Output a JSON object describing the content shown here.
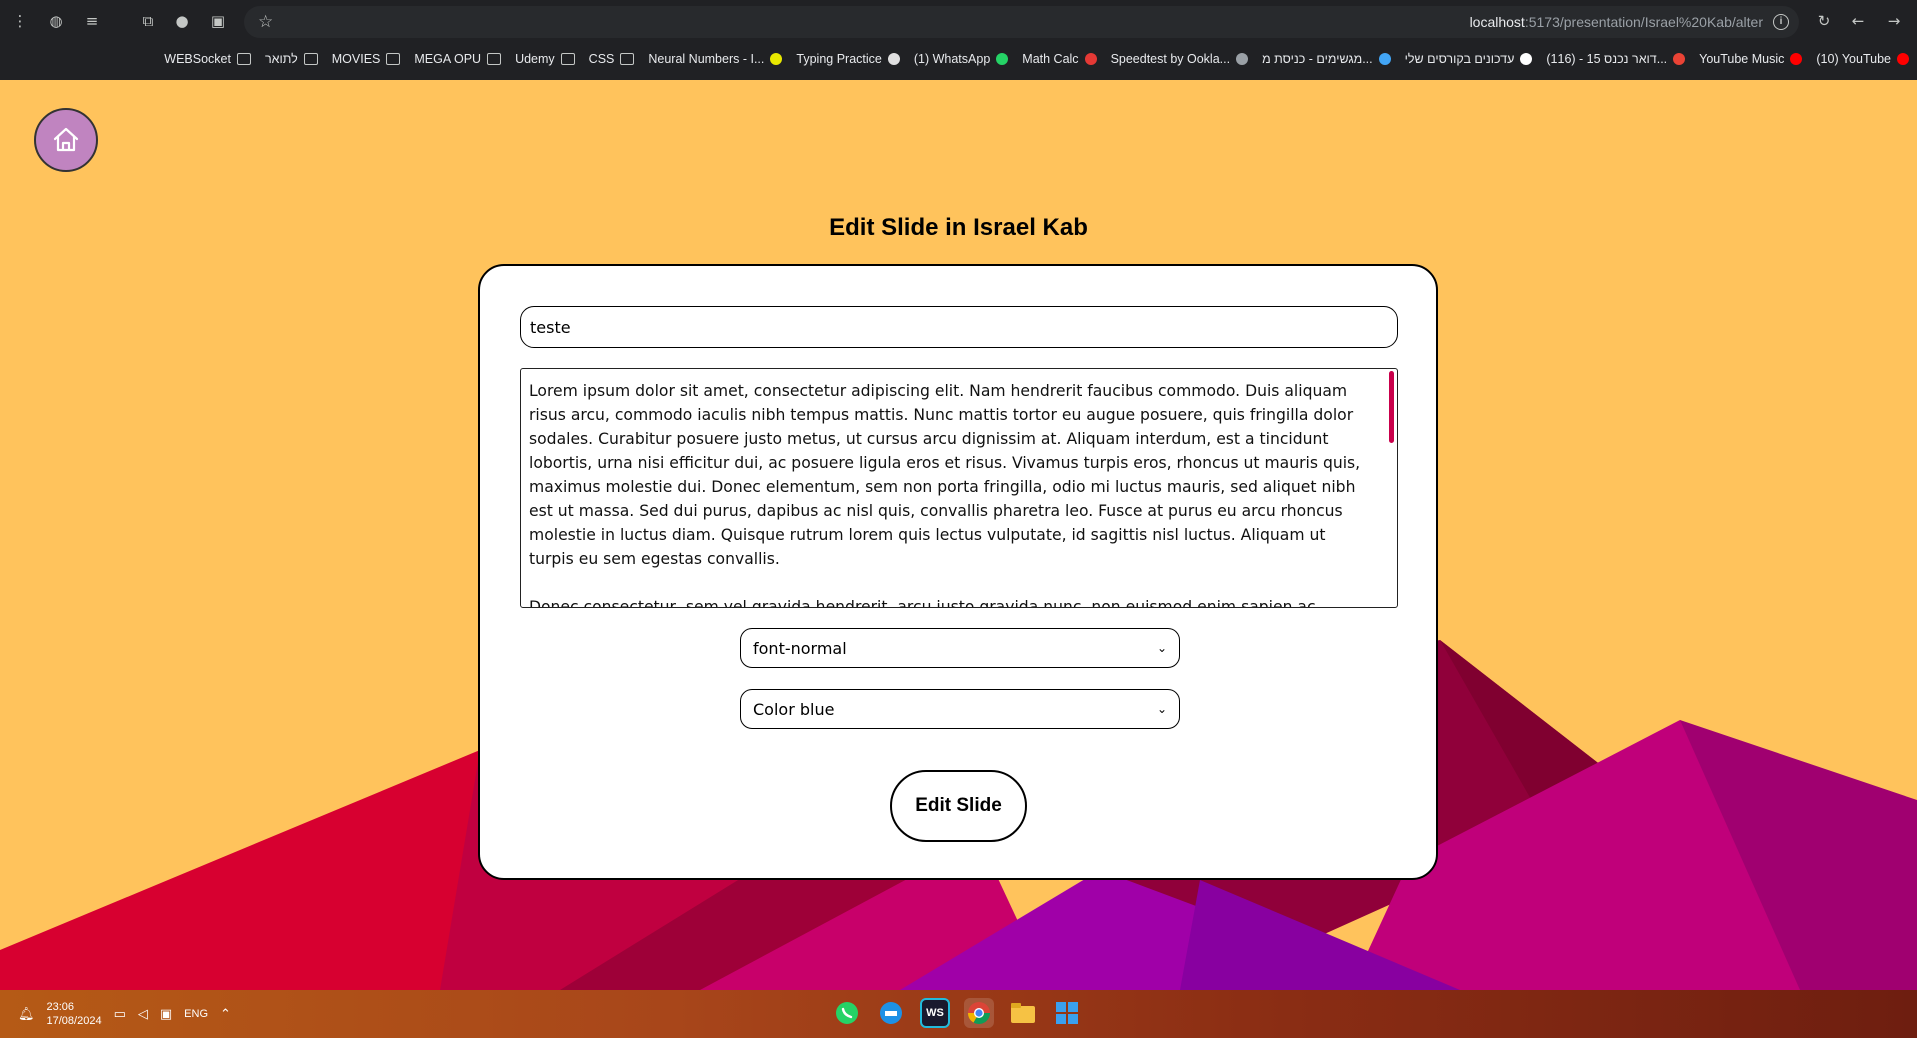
{
  "browser": {
    "url_host": "localhost",
    "url_path": ":5173/presentation/Israel%20Kab/alter",
    "bookmarks": [
      {
        "label": "WEBSocket",
        "icon": "folder-icon"
      },
      {
        "label": "לתואר",
        "icon": "folder-icon"
      },
      {
        "label": "MOVIES",
        "icon": "folder-icon"
      },
      {
        "label": "MEGA OPU",
        "icon": "folder-icon"
      },
      {
        "label": "Udemy",
        "icon": "folder-icon"
      },
      {
        "label": "CSS",
        "icon": "folder-icon"
      },
      {
        "label": "Neural Numbers - I...",
        "icon": "dot-icon"
      },
      {
        "label": "Typing Practice",
        "icon": "page-icon"
      },
      {
        "label": "(1) WhatsApp",
        "icon": "whatsapp-icon"
      },
      {
        "label": "Math Calc",
        "icon": "sy-icon"
      },
      {
        "label": "Speedtest by Ookla...",
        "icon": "speed-icon"
      },
      {
        "label": "מגשימים - כניסת מ...",
        "icon": "plus-icon"
      },
      {
        "label": "עדכונים בקורסים שלי",
        "icon": "m-icon"
      },
      {
        "label": "(116) - דואר נכנס 15...",
        "icon": "gmail-icon"
      },
      {
        "label": "YouTube Music",
        "icon": "ytmusic-icon"
      },
      {
        "label": "(10) YouTube",
        "icon": "youtube-icon"
      }
    ]
  },
  "page": {
    "title": "Edit Slide in Israel Kab"
  },
  "form": {
    "slide_title_value": "teste",
    "content_paragraphs": [
      "Lorem ipsum dolor sit amet, consectetur adipiscing elit. Nam hendrerit faucibus commodo. Duis aliquam risus arcu, commodo iaculis nibh tempus mattis. Nunc mattis tortor eu augue posuere, quis fringilla dolor sodales. Curabitur posuere justo metus, ut cursus arcu dignissim at. Aliquam interdum, est a tincidunt lobortis, urna nisi efficitur dui, ac posuere ligula eros et risus. Vivamus turpis eros, rhoncus ut mauris quis, maximus molestie dui. Donec elementum, sem non porta fringilla, odio mi luctus mauris, sed aliquet nibh est ut massa. Sed dui purus, dapibus ac nisl quis, convallis pharetra leo. Fusce at purus eu arcu rhoncus molestie in luctus diam. Quisque rutrum lorem quis lectus vulputate, id sagittis nisl luctus. Aliquam ut turpis eu sem egestas convallis.",
      "Donec consectetur, sem vel gravida hendrerit, arcu justo gravida nunc, non euismod enim sapien ac turpis. Nulla accumsan justo ac turpis vehicula imperdiet. Ut id consequat odio, ut pulvinar massa. Duis interdum nulla neque, ac"
    ],
    "font_select_value": "font-normal",
    "color_select_value": "Color blue",
    "submit_label": "Edit Slide"
  },
  "taskbar": {
    "time": "23:06",
    "date": "17/08/2024",
    "language": "ENG",
    "apps": [
      "whatsapp",
      "docker",
      "webstorm",
      "chrome",
      "file-explorer",
      "windows"
    ]
  },
  "colors": {
    "page_bg": "#ffc35c",
    "accent_scroll": "#c9004b",
    "home_button": "#c084c0"
  }
}
